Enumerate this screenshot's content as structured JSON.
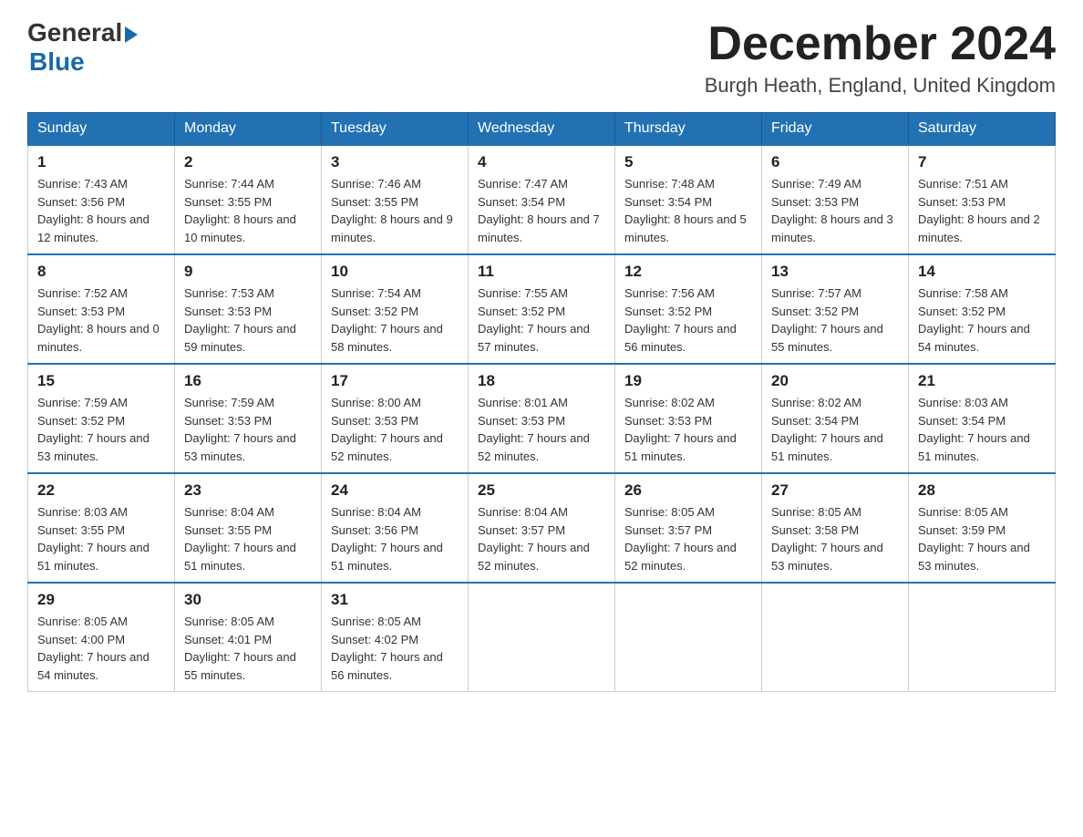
{
  "header": {
    "logo_general": "General",
    "logo_blue": "Blue",
    "main_title": "December 2024",
    "subtitle": "Burgh Heath, England, United Kingdom"
  },
  "columns": [
    "Sunday",
    "Monday",
    "Tuesday",
    "Wednesday",
    "Thursday",
    "Friday",
    "Saturday"
  ],
  "weeks": [
    [
      {
        "day": "1",
        "sunrise": "7:43 AM",
        "sunset": "3:56 PM",
        "daylight": "8 hours and 12 minutes."
      },
      {
        "day": "2",
        "sunrise": "7:44 AM",
        "sunset": "3:55 PM",
        "daylight": "8 hours and 10 minutes."
      },
      {
        "day": "3",
        "sunrise": "7:46 AM",
        "sunset": "3:55 PM",
        "daylight": "8 hours and 9 minutes."
      },
      {
        "day": "4",
        "sunrise": "7:47 AM",
        "sunset": "3:54 PM",
        "daylight": "8 hours and 7 minutes."
      },
      {
        "day": "5",
        "sunrise": "7:48 AM",
        "sunset": "3:54 PM",
        "daylight": "8 hours and 5 minutes."
      },
      {
        "day": "6",
        "sunrise": "7:49 AM",
        "sunset": "3:53 PM",
        "daylight": "8 hours and 3 minutes."
      },
      {
        "day": "7",
        "sunrise": "7:51 AM",
        "sunset": "3:53 PM",
        "daylight": "8 hours and 2 minutes."
      }
    ],
    [
      {
        "day": "8",
        "sunrise": "7:52 AM",
        "sunset": "3:53 PM",
        "daylight": "8 hours and 0 minutes."
      },
      {
        "day": "9",
        "sunrise": "7:53 AM",
        "sunset": "3:53 PM",
        "daylight": "7 hours and 59 minutes."
      },
      {
        "day": "10",
        "sunrise": "7:54 AM",
        "sunset": "3:52 PM",
        "daylight": "7 hours and 58 minutes."
      },
      {
        "day": "11",
        "sunrise": "7:55 AM",
        "sunset": "3:52 PM",
        "daylight": "7 hours and 57 minutes."
      },
      {
        "day": "12",
        "sunrise": "7:56 AM",
        "sunset": "3:52 PM",
        "daylight": "7 hours and 56 minutes."
      },
      {
        "day": "13",
        "sunrise": "7:57 AM",
        "sunset": "3:52 PM",
        "daylight": "7 hours and 55 minutes."
      },
      {
        "day": "14",
        "sunrise": "7:58 AM",
        "sunset": "3:52 PM",
        "daylight": "7 hours and 54 minutes."
      }
    ],
    [
      {
        "day": "15",
        "sunrise": "7:59 AM",
        "sunset": "3:52 PM",
        "daylight": "7 hours and 53 minutes."
      },
      {
        "day": "16",
        "sunrise": "7:59 AM",
        "sunset": "3:53 PM",
        "daylight": "7 hours and 53 minutes."
      },
      {
        "day": "17",
        "sunrise": "8:00 AM",
        "sunset": "3:53 PM",
        "daylight": "7 hours and 52 minutes."
      },
      {
        "day": "18",
        "sunrise": "8:01 AM",
        "sunset": "3:53 PM",
        "daylight": "7 hours and 52 minutes."
      },
      {
        "day": "19",
        "sunrise": "8:02 AM",
        "sunset": "3:53 PM",
        "daylight": "7 hours and 51 minutes."
      },
      {
        "day": "20",
        "sunrise": "8:02 AM",
        "sunset": "3:54 PM",
        "daylight": "7 hours and 51 minutes."
      },
      {
        "day": "21",
        "sunrise": "8:03 AM",
        "sunset": "3:54 PM",
        "daylight": "7 hours and 51 minutes."
      }
    ],
    [
      {
        "day": "22",
        "sunrise": "8:03 AM",
        "sunset": "3:55 PM",
        "daylight": "7 hours and 51 minutes."
      },
      {
        "day": "23",
        "sunrise": "8:04 AM",
        "sunset": "3:55 PM",
        "daylight": "7 hours and 51 minutes."
      },
      {
        "day": "24",
        "sunrise": "8:04 AM",
        "sunset": "3:56 PM",
        "daylight": "7 hours and 51 minutes."
      },
      {
        "day": "25",
        "sunrise": "8:04 AM",
        "sunset": "3:57 PM",
        "daylight": "7 hours and 52 minutes."
      },
      {
        "day": "26",
        "sunrise": "8:05 AM",
        "sunset": "3:57 PM",
        "daylight": "7 hours and 52 minutes."
      },
      {
        "day": "27",
        "sunrise": "8:05 AM",
        "sunset": "3:58 PM",
        "daylight": "7 hours and 53 minutes."
      },
      {
        "day": "28",
        "sunrise": "8:05 AM",
        "sunset": "3:59 PM",
        "daylight": "7 hours and 53 minutes."
      }
    ],
    [
      {
        "day": "29",
        "sunrise": "8:05 AM",
        "sunset": "4:00 PM",
        "daylight": "7 hours and 54 minutes."
      },
      {
        "day": "30",
        "sunrise": "8:05 AM",
        "sunset": "4:01 PM",
        "daylight": "7 hours and 55 minutes."
      },
      {
        "day": "31",
        "sunrise": "8:05 AM",
        "sunset": "4:02 PM",
        "daylight": "7 hours and 56 minutes."
      },
      null,
      null,
      null,
      null
    ]
  ],
  "labels": {
    "sunrise": "Sunrise:",
    "sunset": "Sunset:",
    "daylight": "Daylight:"
  }
}
